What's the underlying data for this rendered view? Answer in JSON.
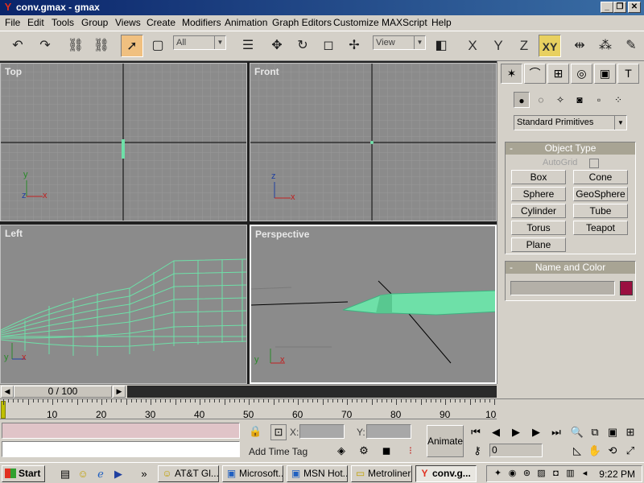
{
  "window": {
    "title": "conv.gmax - gmax",
    "app_icon": "Y"
  },
  "menu": [
    "File",
    "Edit",
    "Tools",
    "Group",
    "Views",
    "Create",
    "Modifiers",
    "Animation",
    "Graph Editors",
    "Customize",
    "MAXScript",
    "Help"
  ],
  "toolbar": {
    "selection_filter": "All",
    "reference_coord": "View",
    "axis_x": "X",
    "axis_y": "Y",
    "axis_z": "Z",
    "axis_xy": "XY"
  },
  "viewports": {
    "top": "Top",
    "front": "Front",
    "left": "Left",
    "perspective": "Perspective",
    "axis_x": "x",
    "axis_y": "y",
    "axis_z": "z"
  },
  "command_panel": {
    "category": "Standard Primitives",
    "object_type": {
      "title": "Object Type",
      "collapse": "-",
      "autogrid": "AutoGrid",
      "buttons": [
        "Box",
        "Cone",
        "Sphere",
        "GeoSphere",
        "Cylinder",
        "Tube",
        "Torus",
        "Teapot",
        "Plane"
      ]
    },
    "name_and_color": {
      "title": "Name and Color",
      "collapse": "-",
      "color": "#9a1040"
    }
  },
  "timeline": {
    "frame_display": "0 / 100",
    "ruler": [
      "10",
      "20",
      "30",
      "40",
      "50",
      "60",
      "70",
      "80",
      "90",
      "10"
    ]
  },
  "status": {
    "x_label": "X:",
    "y_label": "Y:",
    "add_time_tag": "Add Time Tag",
    "animate": "Animate",
    "current_frame": "0"
  },
  "taskbar": {
    "start": "Start",
    "items": [
      "AT&T Gl...",
      "Microsoft...",
      "MSN Hot...",
      "Metroliner",
      "conv.g..."
    ],
    "clock": "9:22 PM",
    "overflow": "»"
  }
}
